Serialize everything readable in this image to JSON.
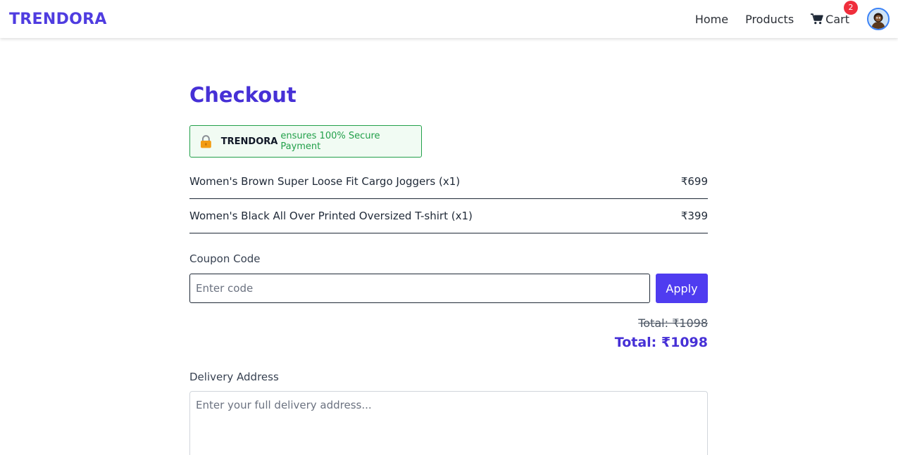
{
  "nav": {
    "brand": "TRENDORA",
    "links": [
      "Home",
      "Products"
    ],
    "cart_label": "Cart",
    "cart_count": "2",
    "cart_icon": "cart-icon",
    "avatar_icon": "avatar"
  },
  "checkout": {
    "title": "Checkout",
    "secure": {
      "brand": "TRENDORA",
      "text": "ensures 100% Secure Payment",
      "icon": "lock-icon"
    },
    "items": [
      {
        "name": "Women's Brown Super Loose Fit Cargo Joggers (x1)",
        "price": "₹699"
      },
      {
        "name": "Women's Black All Over Printed Oversized T-shirt (x1)",
        "price": "₹399"
      }
    ],
    "coupon": {
      "label": "Coupon Code",
      "placeholder": "Enter code",
      "value": "",
      "button": "Apply"
    },
    "total_original": "Total: ₹1098",
    "total_final": "Total: ₹1098",
    "delivery": {
      "label": "Delivery Address",
      "placeholder": "Enter your full delivery address..."
    }
  },
  "colors": {
    "brand": "#4f3ce0",
    "accent": "#4f3cf0",
    "success": "#22a04a",
    "badge": "#ef2e3c"
  }
}
